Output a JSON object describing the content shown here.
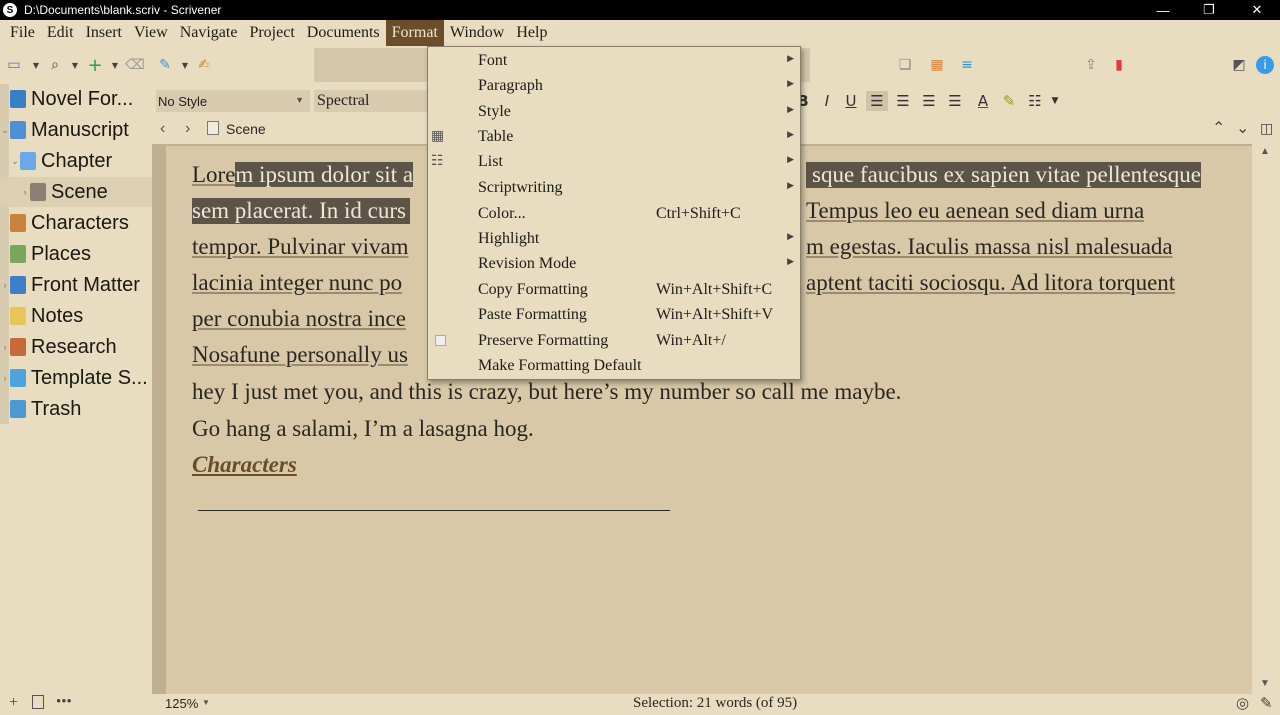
{
  "window": {
    "title": "D:\\Documents\\blank.scriv - Scrivener"
  },
  "window_controls": {
    "minimize": "—",
    "restore": "❐",
    "close": "✕"
  },
  "menubar": [
    "File",
    "Edit",
    "Insert",
    "View",
    "Navigate",
    "Project",
    "Documents",
    "Format",
    "Window",
    "Help"
  ],
  "binder": {
    "items": [
      {
        "label": "Novel For...",
        "icon": "info-triangle-icon",
        "color": "#3a7fc1"
      },
      {
        "label": "Manuscript",
        "icon": "manuscript-icon",
        "color": "#4f8fd4"
      },
      {
        "label": "Chapter",
        "icon": "chapter-folder-icon",
        "color": "#6aa9e6"
      },
      {
        "label": "Scene",
        "icon": "scene-doc-icon",
        "color": "#8a7f72"
      },
      {
        "label": "Characters",
        "icon": "characters-icon",
        "color": "#c9823c"
      },
      {
        "label": "Places",
        "icon": "places-icon",
        "color": "#7aa55b"
      },
      {
        "label": "Front Matter",
        "icon": "front-matter-icon",
        "color": "#3f7ec8"
      },
      {
        "label": "Notes",
        "icon": "notes-icon",
        "color": "#e9c65a"
      },
      {
        "label": "Research",
        "icon": "research-icon",
        "color": "#c8693a"
      },
      {
        "label": "Template S...",
        "icon": "template-icon",
        "color": "#4da3dc"
      },
      {
        "label": "Trash",
        "icon": "trash-icon",
        "color": "#4a9ad6"
      }
    ]
  },
  "formatbar": {
    "style": "No Style",
    "font": "Spectral"
  },
  "header": {
    "doc_title": "Scene"
  },
  "editor": {
    "lines": [
      [
        "Lore",
        "m ipsum dolor sit a",
        "sque faucibus ex sapien vitae pellentesque"
      ],
      [
        "sem placerat. In id curs",
        "Tempus leo eu aenean sed diam urna"
      ],
      [
        "tempor. Pulvinar vivam",
        "m egestas. Iaculis massa nisl malesuada"
      ],
      [
        "lacinia integer nunc po",
        "aptent taciti sociosqu. Ad litora torquent"
      ],
      [
        "per conubia nostra ince"
      ],
      [
        "Nosafune personally us"
      ],
      [
        "hey I just met you, and this is crazy, but here’s my number so call me maybe."
      ],
      [
        "Go hang a salami, I’m a lasagna hog."
      ],
      [
        "Characters"
      ]
    ]
  },
  "statusbar": {
    "zoom": "125%",
    "selection": "Selection: 21 words (of 95)"
  },
  "format_menu": {
    "items": [
      {
        "label": "Font",
        "shortcut": "",
        "submenu": true
      },
      {
        "label": "Paragraph",
        "shortcut": "",
        "submenu": true
      },
      {
        "label": "Style",
        "shortcut": "",
        "submenu": true
      },
      {
        "label": "Table",
        "shortcut": "",
        "submenu": true
      },
      {
        "label": "List",
        "shortcut": "",
        "submenu": true
      },
      {
        "label": "Scriptwriting",
        "shortcut": "",
        "submenu": true
      },
      {
        "label": "Color...",
        "shortcut": "Ctrl+Shift+C",
        "submenu": false
      },
      {
        "label": "Highlight",
        "shortcut": "",
        "submenu": true
      },
      {
        "label": "Revision Mode",
        "shortcut": "",
        "submenu": true
      },
      {
        "label": "Copy Formatting",
        "shortcut": "Win+Alt+Shift+C",
        "submenu": false
      },
      {
        "label": "Paste Formatting",
        "shortcut": "Win+Alt+Shift+V",
        "submenu": false
      },
      {
        "label": "Preserve Formatting",
        "shortcut": "Win+Alt+/",
        "submenu": false
      },
      {
        "label": "Make Formatting Default",
        "shortcut": "",
        "submenu": false
      }
    ]
  },
  "colors": {
    "accent": "#6b4d2a",
    "selection": "#5d5448",
    "page": "#d8c8a8",
    "link": "#6b4d2a"
  }
}
